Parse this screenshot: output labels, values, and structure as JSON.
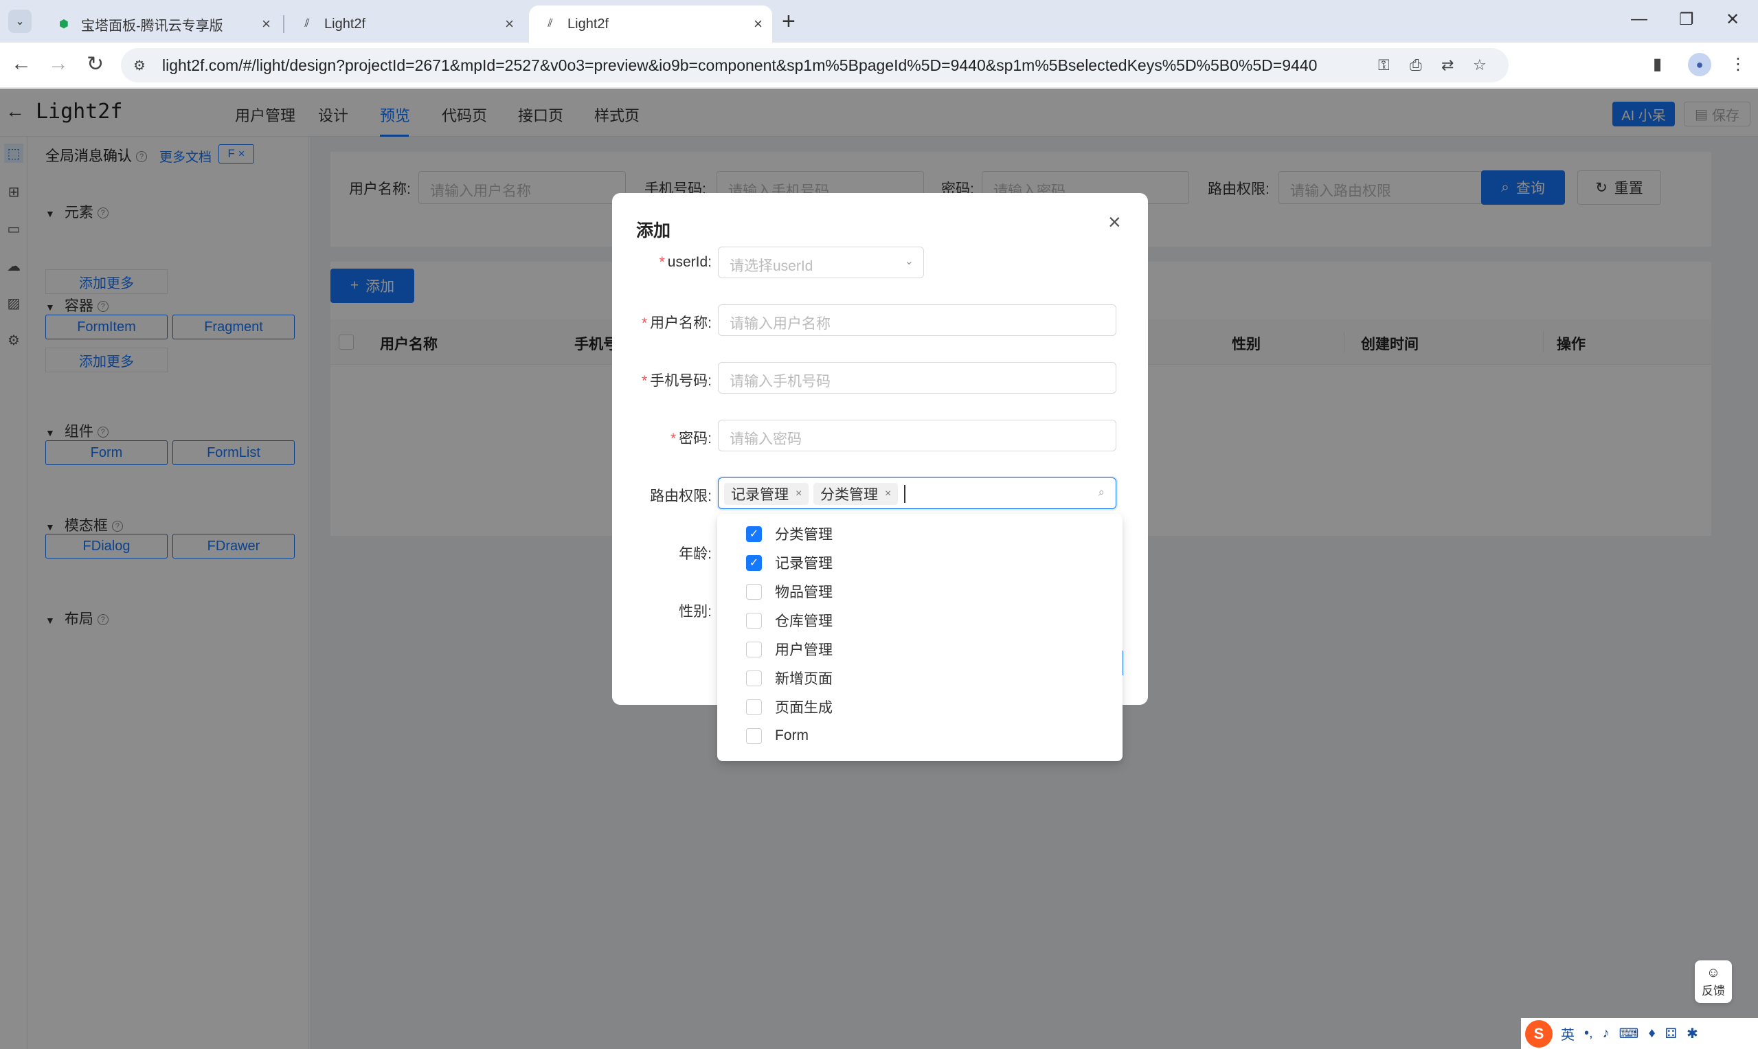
{
  "browser": {
    "tabs": [
      {
        "title": "宝塔面板-腾讯云专享版"
      },
      {
        "title": "Light2f"
      },
      {
        "title": "Light2f"
      }
    ],
    "url": "light2f.com/#/light/design?projectId=2671&mpId=2527&v0o3=preview&io9b=component&sp1m%5BpageId%5D=9440&sp1m%5BselectedKeys%5D%5B0%5D=9440"
  },
  "app": {
    "brand": "Light2f",
    "nav_tabs": [
      "用户管理",
      "设计",
      "预览",
      "代码页",
      "接口页",
      "样式页"
    ],
    "active_tab": "预览",
    "ai_button": "AI 小呆",
    "save_button": "保存"
  },
  "panel": {
    "title": "全局消息确认",
    "docs_link": "更多文档",
    "tag": "F ×",
    "sections": {
      "elements": "元素",
      "containers": "容器",
      "components": "组件",
      "modals": "模态框",
      "layout": "布局"
    },
    "add_more": "添加更多",
    "container_items": [
      "FormItem",
      "Fragment"
    ],
    "component_items": [
      "Form",
      "FormList"
    ],
    "modal_items": [
      "FDialog",
      "FDrawer"
    ]
  },
  "search": {
    "username_label": "用户名称:",
    "username_placeholder": "请输入用户名称",
    "phone_label": "手机号码:",
    "phone_placeholder": "请输入手机号码",
    "password_label": "密码:",
    "password_placeholder": "请输入密码",
    "route_label": "路由权限:",
    "route_placeholder": "请输入路由权限",
    "query_button": "查询",
    "reset_button": "重置"
  },
  "table": {
    "add_button": "添加",
    "columns": [
      "用户名称",
      "手机号",
      "性别",
      "创建时间",
      "操作"
    ]
  },
  "modal": {
    "title": "添加",
    "fields": {
      "userid": {
        "label": "userId:",
        "placeholder": "请选择userId",
        "required": true
      },
      "username": {
        "label": "用户名称:",
        "placeholder": "请输入用户名称",
        "required": true
      },
      "phone": {
        "label": "手机号码:",
        "placeholder": "请输入手机号码",
        "required": true
      },
      "password": {
        "label": "密码:",
        "placeholder": "请输入密码",
        "required": true
      },
      "route": {
        "label": "路由权限:",
        "tags": [
          "记录管理",
          "分类管理"
        ]
      },
      "age": {
        "label": "年龄:"
      },
      "gender": {
        "label": "性别:"
      }
    }
  },
  "dropdown": {
    "options": [
      {
        "label": "分类管理",
        "checked": true
      },
      {
        "label": "记录管理",
        "checked": true
      },
      {
        "label": "物品管理",
        "checked": false
      },
      {
        "label": "仓库管理",
        "checked": false
      },
      {
        "label": "用户管理",
        "checked": false
      },
      {
        "label": "新增页面",
        "checked": false
      },
      {
        "label": "页面生成",
        "checked": false
      },
      {
        "label": "Form",
        "checked": false
      }
    ]
  },
  "feedback": {
    "label": "反馈"
  },
  "ime": {
    "lang": "英"
  },
  "colors": {
    "accent": "#1677ff",
    "required": "#ff4d4f"
  }
}
